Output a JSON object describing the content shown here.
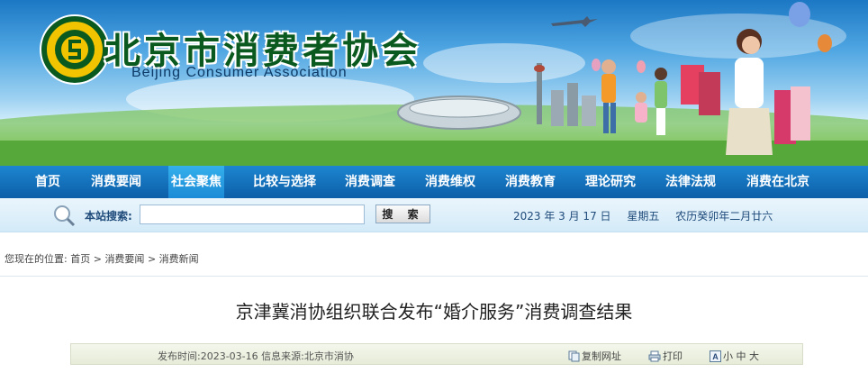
{
  "header": {
    "title_cn": "北京市消费者协会",
    "title_en": "Beijing Consumer Association"
  },
  "nav": {
    "items": [
      {
        "label": "首页"
      },
      {
        "label": "消费要闻"
      },
      {
        "label": "社会聚焦"
      },
      {
        "label": "比较与选择"
      },
      {
        "label": "消费调查"
      },
      {
        "label": "消费维权"
      },
      {
        "label": "消费教育"
      },
      {
        "label": "理论研究"
      },
      {
        "label": "法律法规"
      },
      {
        "label": "消费在北京"
      }
    ],
    "active_index": 2
  },
  "search": {
    "label": "本站搜索:",
    "value": "",
    "button": "搜 索"
  },
  "date": {
    "date": "2023 年 3 月 17 日",
    "weekday": "星期五",
    "lunar": "农历癸卯年二月廿六"
  },
  "breadcrumb": {
    "prefix": "您现在的位置:",
    "items": [
      "首页",
      "消费要闻",
      "消费新闻"
    ],
    "separator": ">"
  },
  "article": {
    "title": "京津冀消协组织联合发布“婚介服务”消费调查结果",
    "publish_label": "发布时间:",
    "publish_date": "2023-03-16",
    "source_label": "信息来源:",
    "source": "北京市消协",
    "copy_url": "复制网址",
    "print": "打印",
    "font_sizes": [
      "小",
      "中",
      "大"
    ]
  },
  "colors": {
    "nav_bg": "#0d5ea8",
    "nav_active": "#34b0ec",
    "logo_green": "#0a5a1f"
  }
}
